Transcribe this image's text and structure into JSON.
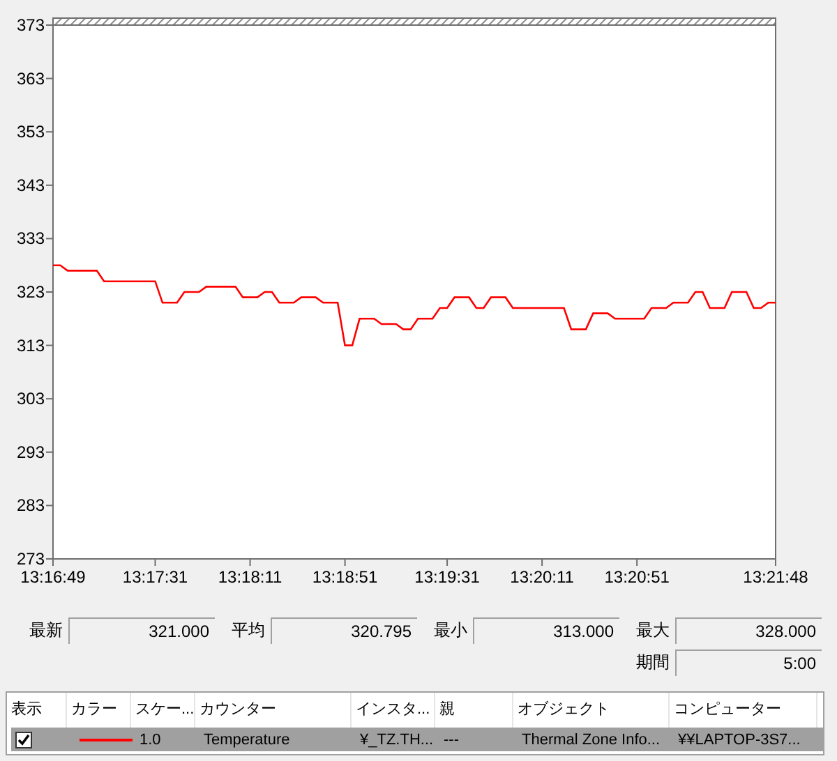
{
  "chart": {
    "chart_data": {
      "type": "line",
      "ylim": [
        273,
        373
      ],
      "yticks": [
        273,
        283,
        293,
        303,
        313,
        323,
        333,
        343,
        353,
        363,
        373
      ],
      "categories": [
        "13:16:49",
        null,
        null,
        null,
        null,
        null,
        null,
        null,
        null,
        null,
        null,
        null,
        null,
        null,
        "13:17:31",
        null,
        null,
        null,
        null,
        null,
        null,
        null,
        null,
        null,
        null,
        null,
        null,
        "13:18:11",
        null,
        null,
        null,
        null,
        null,
        null,
        null,
        null,
        null,
        null,
        null,
        null,
        "13:18:51",
        null,
        null,
        null,
        null,
        null,
        null,
        null,
        null,
        null,
        null,
        null,
        null,
        null,
        "13:19:31",
        null,
        null,
        null,
        null,
        null,
        null,
        null,
        null,
        null,
        null,
        null,
        null,
        "13:20:11",
        null,
        null,
        null,
        null,
        null,
        null,
        null,
        null,
        null,
        null,
        null,
        null,
        "13:20:51",
        null,
        null,
        null,
        null,
        null,
        null,
        null,
        null,
        null,
        null,
        null,
        null,
        null,
        null,
        null,
        null,
        null,
        null,
        "13:21:48"
      ],
      "series": [
        {
          "color": "#ff0000",
          "values": [
            328,
            328,
            327,
            327,
            327,
            327,
            327,
            325,
            325,
            325,
            325,
            325,
            325,
            325,
            325,
            321,
            321,
            321,
            323,
            323,
            323,
            324,
            324,
            324,
            324,
            324,
            322,
            322,
            322,
            323,
            323,
            321,
            321,
            321,
            322,
            322,
            322,
            321,
            321,
            321,
            313,
            313,
            318,
            318,
            318,
            317,
            317,
            317,
            316,
            316,
            318,
            318,
            318,
            320,
            320,
            322,
            322,
            322,
            320,
            320,
            322,
            322,
            322,
            320,
            320,
            320,
            320,
            320,
            320,
            320,
            320,
            316,
            316,
            316,
            319,
            319,
            319,
            318,
            318,
            318,
            318,
            318,
            320,
            320,
            320,
            321,
            321,
            321,
            323,
            323,
            320,
            320,
            320,
            323,
            323,
            323,
            320,
            320,
            321,
            321
          ]
        }
      ]
    }
  },
  "stats_rows": [
    [
      {
        "label": "最新",
        "value": "321.000"
      },
      {
        "label": "平均",
        "value": "320.795"
      },
      {
        "label": "最小",
        "value": "313.000"
      },
      {
        "label": "最大",
        "value": "328.000"
      }
    ],
    [
      {
        "label": "期間",
        "value": "5:00"
      }
    ]
  ],
  "table": {
    "columns": [
      "表示",
      "カラー",
      "スケー...",
      "カウンター",
      "インスタ...",
      "親",
      "オブジェクト",
      "コンピューター"
    ],
    "rows": [
      {
        "selected": true,
        "checked": true,
        "color": "#ff0000",
        "scale": "1.0",
        "counter": "Temperature",
        "instance": "¥_TZ.TH...",
        "parent": "---",
        "object": "Thermal Zone Info...",
        "computer": "¥¥LAPTOP-3S7..."
      }
    ]
  }
}
